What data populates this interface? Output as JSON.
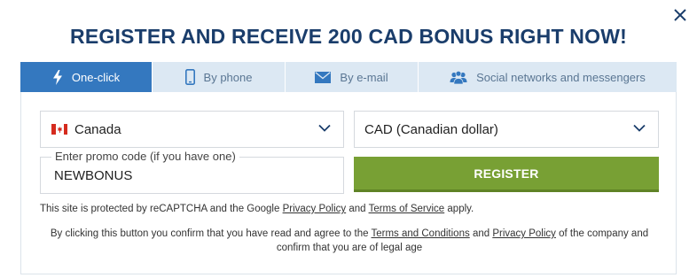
{
  "dialog": {
    "title": "REGISTER AND RECEIVE 200 CAD BONUS RIGHT NOW!",
    "close_icon": "close-icon"
  },
  "tabs": [
    {
      "label": "One-click",
      "icon": "lightning-icon",
      "active": true
    },
    {
      "label": "By phone",
      "icon": "phone-icon",
      "active": false
    },
    {
      "label": "By e-mail",
      "icon": "envelope-icon",
      "active": false
    },
    {
      "label": "Social networks and messengers",
      "icon": "users-icon",
      "active": false
    }
  ],
  "form": {
    "country": {
      "value": "Canada",
      "flag": "canada-flag-icon"
    },
    "currency": {
      "value": "CAD (Canadian dollar)"
    },
    "promo": {
      "label": "Enter promo code (if you have one)",
      "value": "NEWBONUS"
    },
    "register_label": "REGISTER"
  },
  "notice": {
    "captcha_prefix": "This site is protected by reCAPTCHA and the Google",
    "privacy_link": "Privacy Policy",
    "and": "and",
    "terms_of_service_link": "Terms of Service",
    "captcha_suffix": "apply.",
    "terms_prefix": "By clicking this button you confirm that you have read and agree to the",
    "terms_link": "Terms and Conditions",
    "terms_and": "and",
    "terms_privacy_link": "Privacy Policy",
    "terms_suffix": "of the company and confirm that you are of legal age"
  },
  "colors": {
    "title": "#1a3d6b",
    "tab_active": "#3478bf",
    "tab_inactive": "#dce8f3",
    "register_button": "#78a034"
  }
}
